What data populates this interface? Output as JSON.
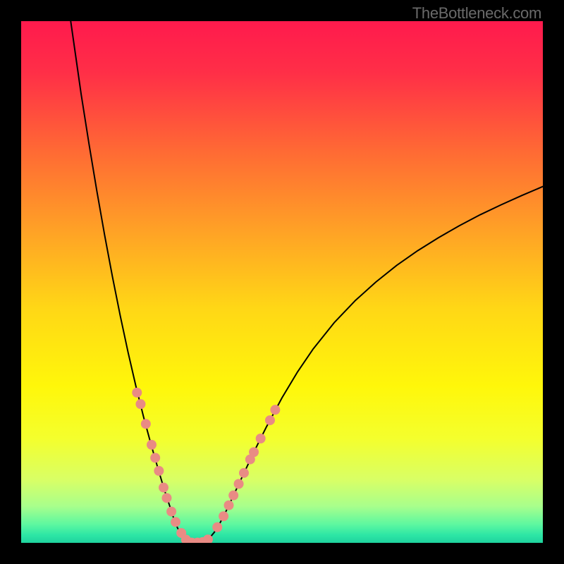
{
  "watermark": "TheBottleneck.com",
  "chart_data": {
    "type": "line",
    "title": "",
    "xlabel": "",
    "ylabel": "",
    "xlim": [
      0,
      100
    ],
    "ylim": [
      0,
      100
    ],
    "grid": false,
    "gradient_stops": [
      {
        "offset": 0.0,
        "color": "#ff1a4d"
      },
      {
        "offset": 0.1,
        "color": "#ff2f47"
      },
      {
        "offset": 0.25,
        "color": "#ff6a34"
      },
      {
        "offset": 0.4,
        "color": "#ffa126"
      },
      {
        "offset": 0.55,
        "color": "#ffd716"
      },
      {
        "offset": 0.7,
        "color": "#fff70a"
      },
      {
        "offset": 0.8,
        "color": "#f4ff2d"
      },
      {
        "offset": 0.88,
        "color": "#d8ff66"
      },
      {
        "offset": 0.93,
        "color": "#a8ff8c"
      },
      {
        "offset": 0.965,
        "color": "#5cf7a0"
      },
      {
        "offset": 0.985,
        "color": "#2de6a5"
      },
      {
        "offset": 1.0,
        "color": "#1fd39e"
      }
    ],
    "series": [
      {
        "name": "bottleneck-curve",
        "color": "#000000",
        "stroke_width": 2,
        "x": [
          9.5,
          10.5,
          11.5,
          13.0,
          14.5,
          16.0,
          17.5,
          19.0,
          20.5,
          22.0,
          23.5,
          25.0,
          26.3,
          27.5,
          28.5,
          29.3,
          30.0,
          30.8,
          31.5,
          32.3,
          33.0,
          34.0,
          35.0,
          36.0,
          37.0,
          38.0,
          39.0,
          40.0,
          41.5,
          43.0,
          45.0,
          47.0,
          50.0,
          53.0,
          56.0,
          60.0,
          64.0,
          68.0,
          72.0,
          76.0,
          80.0,
          84.0,
          88.0,
          92.0,
          96.0,
          100.0
        ],
        "y": [
          100.0,
          93.0,
          86.0,
          76.5,
          67.5,
          59.0,
          51.0,
          43.5,
          36.5,
          30.0,
          24.0,
          18.5,
          14.0,
          10.0,
          7.0,
          4.5,
          2.8,
          1.5,
          0.6,
          0.1,
          0.0,
          0.0,
          0.2,
          0.8,
          2.0,
          3.6,
          5.5,
          7.6,
          10.8,
          14.0,
          18.2,
          22.2,
          27.8,
          32.8,
          37.2,
          42.2,
          46.4,
          50.0,
          53.2,
          56.0,
          58.5,
          60.8,
          62.9,
          64.8,
          66.6,
          68.3
        ]
      }
    ],
    "markers": {
      "name": "highlight-points",
      "color": "#e98b84",
      "radius": 7,
      "points": [
        {
          "x": 22.2,
          "y": 28.8
        },
        {
          "x": 22.9,
          "y": 26.6
        },
        {
          "x": 23.9,
          "y": 22.8
        },
        {
          "x": 25.0,
          "y": 18.8
        },
        {
          "x": 25.7,
          "y": 16.3
        },
        {
          "x": 26.4,
          "y": 13.8
        },
        {
          "x": 27.3,
          "y": 10.6
        },
        {
          "x": 27.9,
          "y": 8.6
        },
        {
          "x": 28.8,
          "y": 6.0
        },
        {
          "x": 29.6,
          "y": 4.0
        },
        {
          "x": 30.7,
          "y": 1.9
        },
        {
          "x": 31.6,
          "y": 0.6
        },
        {
          "x": 32.7,
          "y": 0.05
        },
        {
          "x": 33.8,
          "y": 0.05
        },
        {
          "x": 34.8,
          "y": 0.15
        },
        {
          "x": 35.8,
          "y": 0.65
        },
        {
          "x": 37.6,
          "y": 3.0
        },
        {
          "x": 38.8,
          "y": 5.1
        },
        {
          "x": 39.8,
          "y": 7.2
        },
        {
          "x": 40.7,
          "y": 9.1
        },
        {
          "x": 41.7,
          "y": 11.3
        },
        {
          "x": 42.7,
          "y": 13.4
        },
        {
          "x": 43.9,
          "y": 16.0
        },
        {
          "x": 44.6,
          "y": 17.4
        },
        {
          "x": 45.9,
          "y": 20.0
        },
        {
          "x": 47.7,
          "y": 23.5
        },
        {
          "x": 48.7,
          "y": 25.5
        }
      ]
    }
  }
}
